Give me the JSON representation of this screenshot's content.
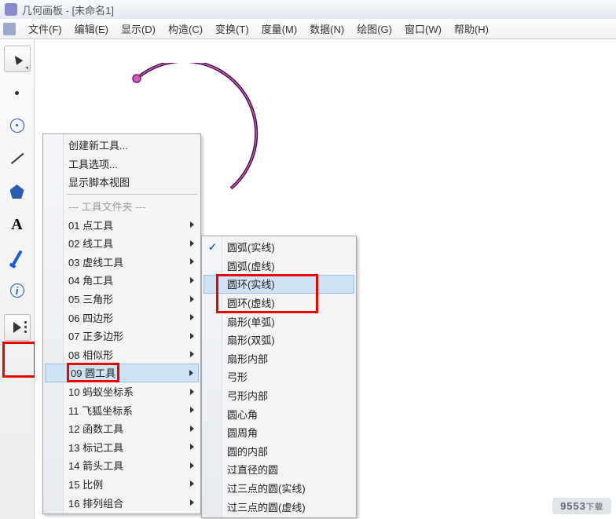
{
  "window": {
    "title": "几何画板 - [未命名1]"
  },
  "menubar": {
    "items": [
      "文件(F)",
      "编辑(E)",
      "显示(D)",
      "构造(C)",
      "变换(T)",
      "度量(M)",
      "数据(N)",
      "绘图(G)",
      "窗口(W)",
      "帮助(H)"
    ]
  },
  "toolbar": {
    "arrow": "arrow-tool",
    "point": "point-tool",
    "circle": "circle-tool",
    "line": "line-tool",
    "polygon": "polygon-tool",
    "text": "A",
    "pen": "pen-tool",
    "info": "i",
    "custom": "custom-tool"
  },
  "menu1": {
    "create_tool": "创建新工具...",
    "tool_options": "工具选项...",
    "show_script": "显示脚本视图",
    "folder_header": "--- 工具文件夹 ---",
    "items": [
      "01 点工具",
      "02 线工具",
      "03 虚线工具",
      "04 角工具",
      "05 三角形",
      "06 四边形",
      "07 正多边形",
      "08 相似形",
      "09 圆工具",
      "10 蚂蚁坐标系",
      "11 飞狐坐标系",
      "12 函数工具",
      "13 标记工具",
      "14 箭头工具",
      "15 比例",
      "16 排列组合"
    ]
  },
  "menu2": {
    "items": [
      "圆弧(实线)",
      "圆弧(虚线)",
      "圆环(实线)",
      "圆环(虚线)",
      "扇形(单弧)",
      "扇形(双弧)",
      "扇形内部",
      "弓形",
      "弓形内部",
      "圆心角",
      "圆周角",
      "圆的内部",
      "过直径的圆",
      "过三点的圆(实线)",
      "过三点的圆(虚线)"
    ]
  },
  "watermark": {
    "main": "9553",
    "suffix": "下载"
  }
}
